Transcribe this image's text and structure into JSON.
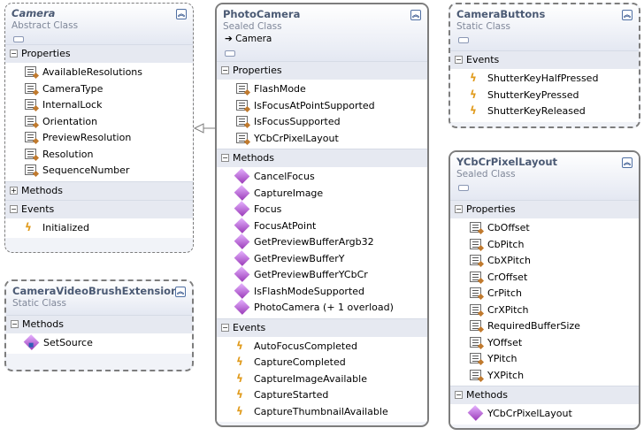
{
  "section_labels": {
    "properties": "Properties",
    "methods": "Methods",
    "events": "Events"
  },
  "camera": {
    "name": "Camera",
    "kind": "Abstract Class",
    "properties": [
      "AvailableResolutions",
      "CameraType",
      "InternalLock",
      "Orientation",
      "PreviewResolution",
      "Resolution",
      "SequenceNumber"
    ],
    "events": [
      "Initialized"
    ]
  },
  "camera_video_brush_extensions": {
    "name": "CameraVideoBrushExtensions",
    "kind": "Static Class",
    "methods": [
      "SetSource"
    ]
  },
  "photo_camera": {
    "name": "PhotoCamera",
    "kind": "Sealed Class",
    "base": "Camera",
    "properties": [
      "FlashMode",
      "IsFocusAtPointSupported",
      "IsFocusSupported",
      "YCbCrPixelLayout"
    ],
    "methods": [
      "CancelFocus",
      "CaptureImage",
      "Focus",
      "FocusAtPoint",
      "GetPreviewBufferArgb32",
      "GetPreviewBufferY",
      "GetPreviewBufferYCbCr",
      "IsFlashModeSupported",
      "PhotoCamera (+ 1 overload)"
    ],
    "events": [
      "AutoFocusCompleted",
      "CaptureCompleted",
      "CaptureImageAvailable",
      "CaptureStarted",
      "CaptureThumbnailAvailable"
    ]
  },
  "camera_buttons": {
    "name": "CameraButtons",
    "kind": "Static Class",
    "events": [
      "ShutterKeyHalfPressed",
      "ShutterKeyPressed",
      "ShutterKeyReleased"
    ]
  },
  "ycbcr_pixel_layout": {
    "name": "YCbCrPixelLayout",
    "kind": "Sealed Class",
    "properties": [
      "CbOffset",
      "CbPitch",
      "CbXPitch",
      "CrOffset",
      "CrPitch",
      "CrXPitch",
      "RequiredBufferSize",
      "YOffset",
      "YPitch",
      "YXPitch"
    ],
    "methods": [
      "YCbCrPixelLayout"
    ]
  }
}
